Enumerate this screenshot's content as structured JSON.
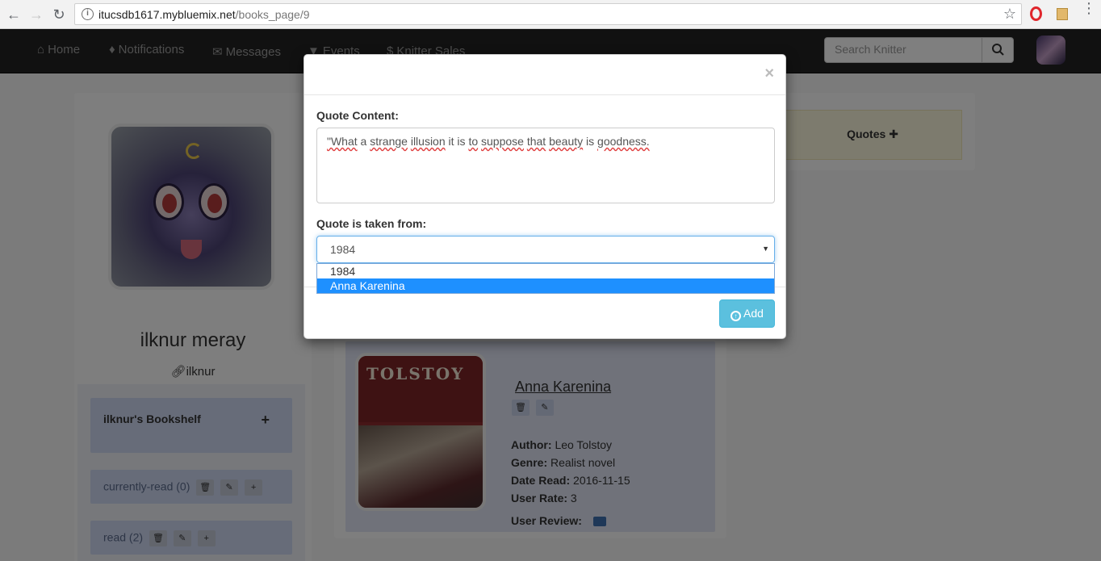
{
  "browser": {
    "url_host": "itucsdb1617.mybluemix.net",
    "url_path": "/books_page/9"
  },
  "navbar": {
    "items": [
      {
        "label": "Home",
        "icon": "home-icon"
      },
      {
        "label": "Notifications",
        "icon": "bell-icon"
      },
      {
        "label": "Messages",
        "icon": "envelope-icon"
      },
      {
        "label": "Events",
        "icon": "filter-icon"
      },
      {
        "label": "Knitter Sales",
        "icon": "dollar-icon"
      }
    ],
    "search_placeholder": "Search Knitter"
  },
  "profile": {
    "name": "ilknur meray",
    "handle": "ilknur",
    "bookshelf_title": "ilknur's Bookshelf",
    "shelves": [
      {
        "label": "currently-read (0)"
      },
      {
        "label": "read (2)"
      }
    ]
  },
  "quotes": {
    "title": "Quotes"
  },
  "book": {
    "title": "Anna Karenina",
    "cover_text": "TOLSTOY",
    "author_label": "Author:",
    "author": "Leo Tolstoy",
    "genre_label": "Genre:",
    "genre": "Realist novel",
    "date_label": "Date Read:",
    "date_read": "2016-11-15",
    "rate_label": "User Rate:",
    "rate": "3",
    "review_label": "User Review:"
  },
  "modal": {
    "close": "×",
    "content_label": "Quote Content:",
    "quote_words": [
      "\"What",
      "a",
      "strange",
      "illusion",
      "it",
      "is",
      "to",
      "suppose",
      "that",
      "beauty",
      "is",
      "goodness."
    ],
    "source_label": "Quote is taken from:",
    "selected": "1984",
    "options": [
      "1984",
      "Anna Karenina"
    ],
    "highlighted_option": "Anna Karenina",
    "add_label": "Add"
  },
  "colors": {
    "accent": "#5bc0de",
    "navbar_bg": "#222222",
    "option_highlight": "#1e90ff"
  }
}
